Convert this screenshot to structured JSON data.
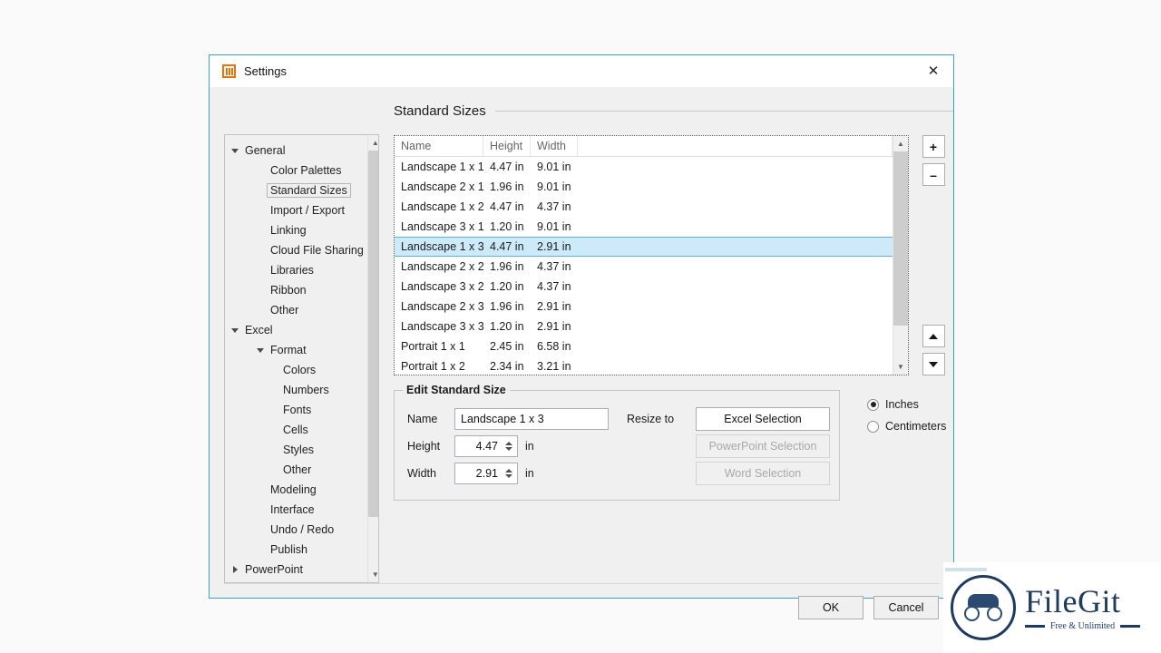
{
  "window": {
    "title": "Settings",
    "icon": "app-icon",
    "close_label": "✕",
    "border_color": "#3da3c4"
  },
  "sidebar": {
    "items": [
      {
        "label": "General",
        "level": 0,
        "twisty": "down",
        "selected": false
      },
      {
        "label": "Color Palettes",
        "level": 1,
        "twisty": "none",
        "selected": false
      },
      {
        "label": "Standard Sizes",
        "level": 1,
        "twisty": "none",
        "selected": true
      },
      {
        "label": "Import / Export",
        "level": 1,
        "twisty": "none",
        "selected": false
      },
      {
        "label": "Linking",
        "level": 1,
        "twisty": "none",
        "selected": false
      },
      {
        "label": "Cloud File Sharing",
        "level": 1,
        "twisty": "none",
        "selected": false
      },
      {
        "label": "Libraries",
        "level": 1,
        "twisty": "none",
        "selected": false
      },
      {
        "label": "Ribbon",
        "level": 1,
        "twisty": "none",
        "selected": false
      },
      {
        "label": "Other",
        "level": 1,
        "twisty": "none",
        "selected": false
      },
      {
        "label": "Excel",
        "level": 0,
        "twisty": "down",
        "selected": false
      },
      {
        "label": "Format",
        "level": 1,
        "twisty": "down",
        "selected": false
      },
      {
        "label": "Colors",
        "level": 2,
        "twisty": "none",
        "selected": false
      },
      {
        "label": "Numbers",
        "level": 2,
        "twisty": "none",
        "selected": false
      },
      {
        "label": "Fonts",
        "level": 2,
        "twisty": "none",
        "selected": false
      },
      {
        "label": "Cells",
        "level": 2,
        "twisty": "none",
        "selected": false
      },
      {
        "label": "Styles",
        "level": 2,
        "twisty": "none",
        "selected": false
      },
      {
        "label": "Other",
        "level": 2,
        "twisty": "none",
        "selected": false
      },
      {
        "label": "Modeling",
        "level": 1,
        "twisty": "none",
        "selected": false
      },
      {
        "label": "Interface",
        "level": 1,
        "twisty": "none",
        "selected": false
      },
      {
        "label": "Undo / Redo",
        "level": 1,
        "twisty": "none",
        "selected": false
      },
      {
        "label": "Publish",
        "level": 1,
        "twisty": "none",
        "selected": false
      },
      {
        "label": "PowerPoint",
        "level": 0,
        "twisty": "right",
        "selected": false
      }
    ]
  },
  "section": {
    "title": "Standard Sizes"
  },
  "grid": {
    "columns": [
      "Name",
      "Height",
      "Width"
    ],
    "selected_index": 4,
    "rows": [
      {
        "name": "Landscape 1 x 1",
        "height": "4.47 in",
        "width": "9.01 in"
      },
      {
        "name": "Landscape 2 x 1",
        "height": "1.96 in",
        "width": "9.01 in"
      },
      {
        "name": "Landscape 1 x 2",
        "height": "4.47 in",
        "width": "4.37 in"
      },
      {
        "name": "Landscape 3 x 1",
        "height": "1.20 in",
        "width": "9.01 in"
      },
      {
        "name": "Landscape 1 x 3",
        "height": "4.47 in",
        "width": "2.91 in"
      },
      {
        "name": "Landscape 2 x 2",
        "height": "1.96 in",
        "width": "4.37 in"
      },
      {
        "name": "Landscape 3 x 2",
        "height": "1.20 in",
        "width": "4.37 in"
      },
      {
        "name": "Landscape 2 x 3",
        "height": "1.96 in",
        "width": "2.91 in"
      },
      {
        "name": "Landscape 3 x 3",
        "height": "1.20 in",
        "width": "2.91 in"
      },
      {
        "name": "Portrait 1 x 1",
        "height": "2.45 in",
        "width": "6.58 in"
      },
      {
        "name": "Portrait 1 x 2",
        "height": "2.34 in",
        "width": "3.21 in"
      }
    ],
    "side_buttons": {
      "add": "+",
      "remove": "–",
      "move_up": "move-up",
      "move_down": "move-down"
    }
  },
  "edit_group": {
    "legend": "Edit Standard Size",
    "name_label": "Name",
    "name_value": "Landscape 1 x 3",
    "height_label": "Height",
    "height_value": "4.47",
    "height_unit": "in",
    "width_label": "Width",
    "width_value": "2.91",
    "width_unit": "in",
    "resize_label": "Resize to",
    "resize_buttons": [
      {
        "label": "Excel Selection",
        "disabled": false
      },
      {
        "label": "PowerPoint Selection",
        "disabled": true
      },
      {
        "label": "Word Selection",
        "disabled": true
      }
    ]
  },
  "units": {
    "options": [
      {
        "label": "Inches",
        "selected": true
      },
      {
        "label": "Centimeters",
        "selected": false
      }
    ]
  },
  "footer": {
    "ok_label": "OK",
    "cancel_label": "Cancel"
  },
  "watermark": {
    "name": "FileGit",
    "tagline": "Free & Unlimited",
    "color": "#1e3a5f"
  }
}
